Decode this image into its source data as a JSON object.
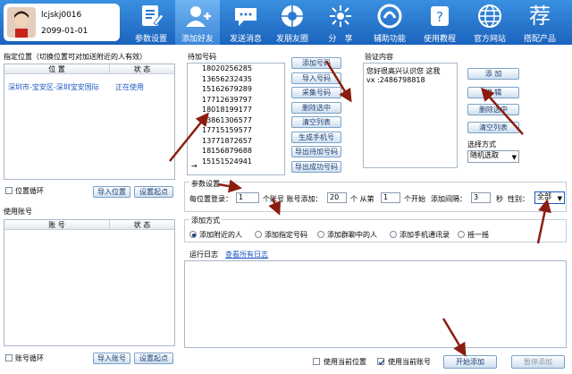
{
  "user": {
    "name": "lcjskj0016",
    "date": "2099-01-01"
  },
  "toolbar": [
    {
      "label": "参数设置",
      "icon": "document-edit-icon"
    },
    {
      "label": "添加好友",
      "icon": "add-user-icon"
    },
    {
      "label": "发送消息",
      "icon": "chat-bubble-icon"
    },
    {
      "label": "发朋友圈",
      "icon": "camera-shutter-icon"
    },
    {
      "label": "分　享",
      "icon": "share-burst-icon"
    },
    {
      "label": "辅助功能",
      "icon": "circle-tool-icon"
    },
    {
      "label": "使用教程",
      "icon": "help-book-icon"
    },
    {
      "label": "官方网站",
      "icon": "globe-icon"
    },
    {
      "label": "搭配产品",
      "icon": "recommend-icon",
      "glyph": "荐"
    }
  ],
  "location": {
    "title": "指定位置（切换位置可对加送附近的人有效）",
    "col_pos": "位  置",
    "col_state": "状  态",
    "rows": [
      {
        "pos": "深圳市-宝安区-深圳宝安国际",
        "state": "正在使用"
      }
    ],
    "loop_label": "位置循环",
    "import_btn": "导入位置",
    "set_start_btn": "设置起点"
  },
  "accounts": {
    "title": "使用账号",
    "col_acct": "账  号",
    "col_state": "状  态",
    "loop_label": "账号循环",
    "import_btn": "导入账号",
    "set_start_btn": "设置起点"
  },
  "phones": {
    "title": "待加号码",
    "list": [
      "18020256285",
      "13656232435",
      "15162679289",
      "17712639797",
      "18018199177",
      "13861306577",
      "17715159577",
      "13771872657",
      "18156879688",
      "15151524941"
    ],
    "current_marker": "→"
  },
  "phone_btns": [
    "添加号码",
    "导入号码",
    "采集号码",
    "删除选中",
    "清空列表",
    "生成手机号",
    "导出待加号码",
    "导出成功号码"
  ],
  "verify": {
    "title": "验证内容",
    "text1": "您好很高兴认识您 这我",
    "text2": "vx :2486798818",
    "add_btn": "添  加",
    "edit_btn": "编  辑",
    "delete_btn": "删除选中",
    "clear_btn": "清空列表",
    "mode_label": "选择方式",
    "mode_value": "随机选取"
  },
  "params": {
    "title": "参数设置",
    "each_login": "每位置登录：",
    "each_login_val": "1",
    "per_acct": "个账号 账号添加：",
    "per_acct_val": "20",
    "start_from": "个 从第",
    "start_val": "1",
    "start_unit": "个开始",
    "interval": "添加间隔：",
    "interval_val": "3",
    "seconds": "秒",
    "gender": "性别：",
    "gender_val": "全部"
  },
  "method": {
    "title": "添加方式",
    "options": [
      "添加附近的人",
      "添加指定号码",
      "添加群聊中的人",
      "添加手机通讯录",
      "摇一摇"
    ],
    "selected": 0
  },
  "log": {
    "title": "运行日志",
    "view_all": "查看所有日志"
  },
  "footer": {
    "use_current_pos": "使用当前位置",
    "use_current_acct": "使用当前账号",
    "start_btn": "开始添加",
    "pause_btn": "暂停添加",
    "use_current_pos_checked": false,
    "use_current_acct_checked": true
  },
  "colors": {
    "toolbar": "#2a78d2",
    "accent": "#1a3f73",
    "arrow": "#8b1d10",
    "selected_row": "#1c58c2"
  }
}
